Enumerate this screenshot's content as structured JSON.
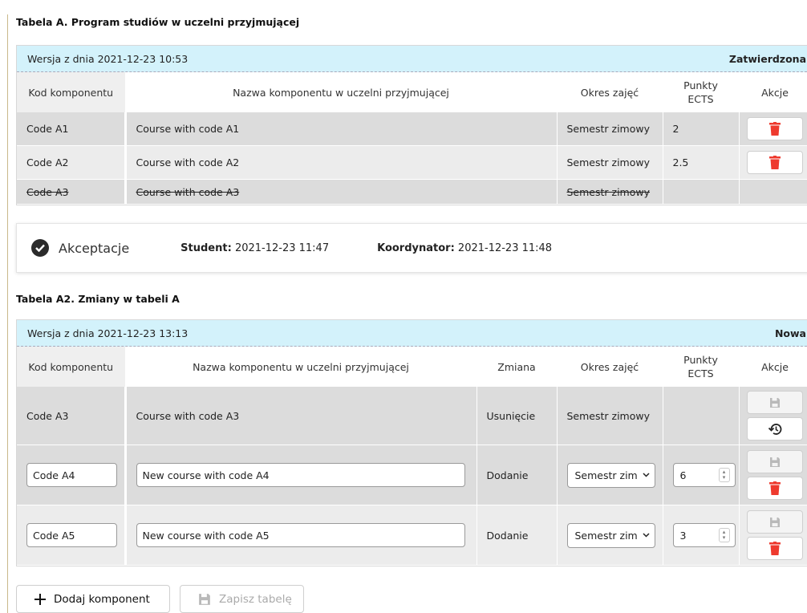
{
  "tableA": {
    "title": "Tabela A. Program studiów w uczelni przyjmującej",
    "version": "Wersja z dnia 2021-12-23 10:53",
    "status": "Zatwierdzona",
    "headers": {
      "code": "Kod komponentu",
      "name": "Nazwa komponentu w uczelni przyjmującej",
      "period": "Okres zajęć",
      "ects_line1": "Punkty",
      "ects_line2": "ECTS",
      "actions": "Akcje"
    },
    "rows": [
      {
        "code": "Code A1",
        "name": "Course with code A1",
        "period": "Semestr zimowy",
        "ects": "2"
      },
      {
        "code": "Code A2",
        "name": "Course with code A2",
        "period": "Semestr zimowy",
        "ects": "2.5"
      },
      {
        "code": "Code A3",
        "name": "Course with code A3",
        "period": "Semestr zimowy",
        "ects": ""
      }
    ]
  },
  "acceptance": {
    "label": "Akceptacje",
    "student_label": "Student:",
    "student_value": "2021-12-23 11:47",
    "coordinator_label": "Koordynator:",
    "coordinator_value": "2021-12-23 11:48"
  },
  "tableA2": {
    "title": "Tabela A2. Zmiany w tabeli A",
    "version": "Wersja z dnia 2021-12-23 13:13",
    "status": "Nowa",
    "headers": {
      "code": "Kod komponentu",
      "name": "Nazwa komponentu w uczelni przyjmującej",
      "change": "Zmiana",
      "period": "Okres zajęć",
      "ects_line1": "Punkty",
      "ects_line2": "ECTS",
      "actions": "Akcje"
    },
    "rows": [
      {
        "code": "Code A3",
        "name": "Course with code A3",
        "change": "Usunięcie",
        "period": "Semestr zimowy",
        "ects": ""
      },
      {
        "code": "Code A4",
        "name": "New course with code A4",
        "change": "Dodanie",
        "period": "Semestr zim",
        "ects": "6"
      },
      {
        "code": "Code A5",
        "name": "New course with code A5",
        "change": "Dodanie",
        "period": "Semestr zim",
        "ects": "3"
      }
    ]
  },
  "buttons": {
    "add_component": "Dodaj komponent",
    "save_table": "Zapisz tabelę"
  },
  "colors": {
    "version_bar": "#d3f2fb",
    "delete_icon": "#ee3a2e",
    "row_dark": "#dcdcdc",
    "row_light": "#ececec"
  },
  "icons": [
    "trash-icon",
    "save-icon",
    "restore-icon",
    "check-circle-icon",
    "plus-icon",
    "chevron-down-icon"
  ]
}
